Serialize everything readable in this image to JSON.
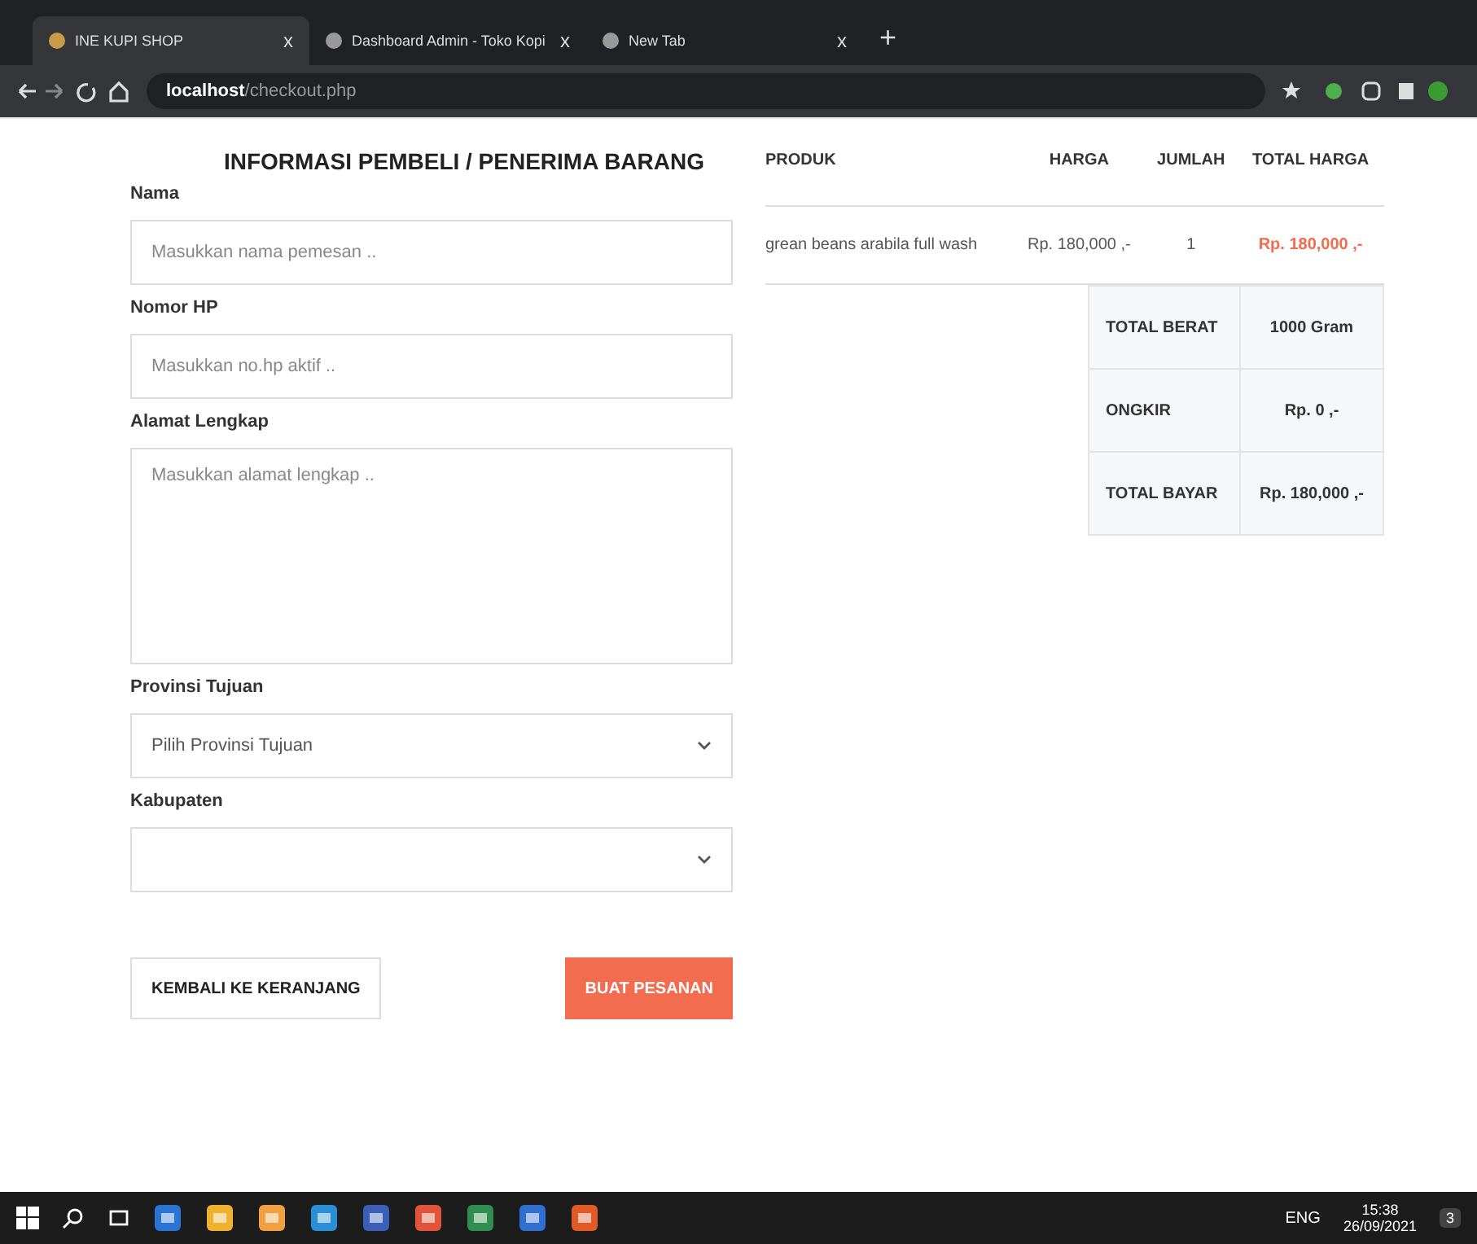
{
  "browser": {
    "tabs": [
      {
        "title": "INE KUPI SHOP",
        "close_glyph": "x",
        "selected": true
      },
      {
        "title": "Dashboard Admin - Toko Kopi",
        "close_glyph": "x",
        "selected": false
      },
      {
        "title": "New Tab",
        "close_glyph": "x",
        "selected": false
      }
    ],
    "new_tab_glyph": "+",
    "url_host": "localhost",
    "url_path": "/checkout.php"
  },
  "form": {
    "title": "INFORMASI PEMBELI / PENERIMA BARANG",
    "fields": [
      {
        "kind": "input",
        "label": "Nama",
        "placeholder": "Masukkan nama pemesan .."
      },
      {
        "kind": "input",
        "label": "Nomor HP",
        "placeholder": "Masukkan no.hp aktif .."
      },
      {
        "kind": "textarea",
        "label": "Alamat Lengkap",
        "placeholder": "Masukkan alamat lengkap .."
      },
      {
        "kind": "select",
        "label": "Provinsi Tujuan",
        "value": "Pilih Provinsi Tujuan"
      },
      {
        "kind": "select",
        "label": "Kabupaten"
      }
    ],
    "buttons": [
      {
        "kind": "outline",
        "label": "KEMBALI KE KERANJANG"
      },
      {
        "kind": "primary",
        "label": "BUAT PESANAN"
      }
    ]
  },
  "order": {
    "columns": [
      "PRODUK",
      "HARGA",
      "JUMLAH",
      "TOTAL HARGA"
    ],
    "rows": [
      [
        "grean beans arabila full wash",
        "Rp. 180,000 ,-",
        "1",
        "Rp. 180,000 ,-"
      ]
    ],
    "summary": [
      [
        "TOTAL BERAT",
        "1000 Gram"
      ],
      [
        "ONGKIR",
        "Rp. 0 ,-"
      ],
      [
        "TOTAL BAYAR",
        "Rp. 180,000 ,-"
      ]
    ]
  },
  "taskbar": {
    "language": "ENG",
    "time": "15:38",
    "date": "26/09/2021",
    "notifications": "3"
  }
}
